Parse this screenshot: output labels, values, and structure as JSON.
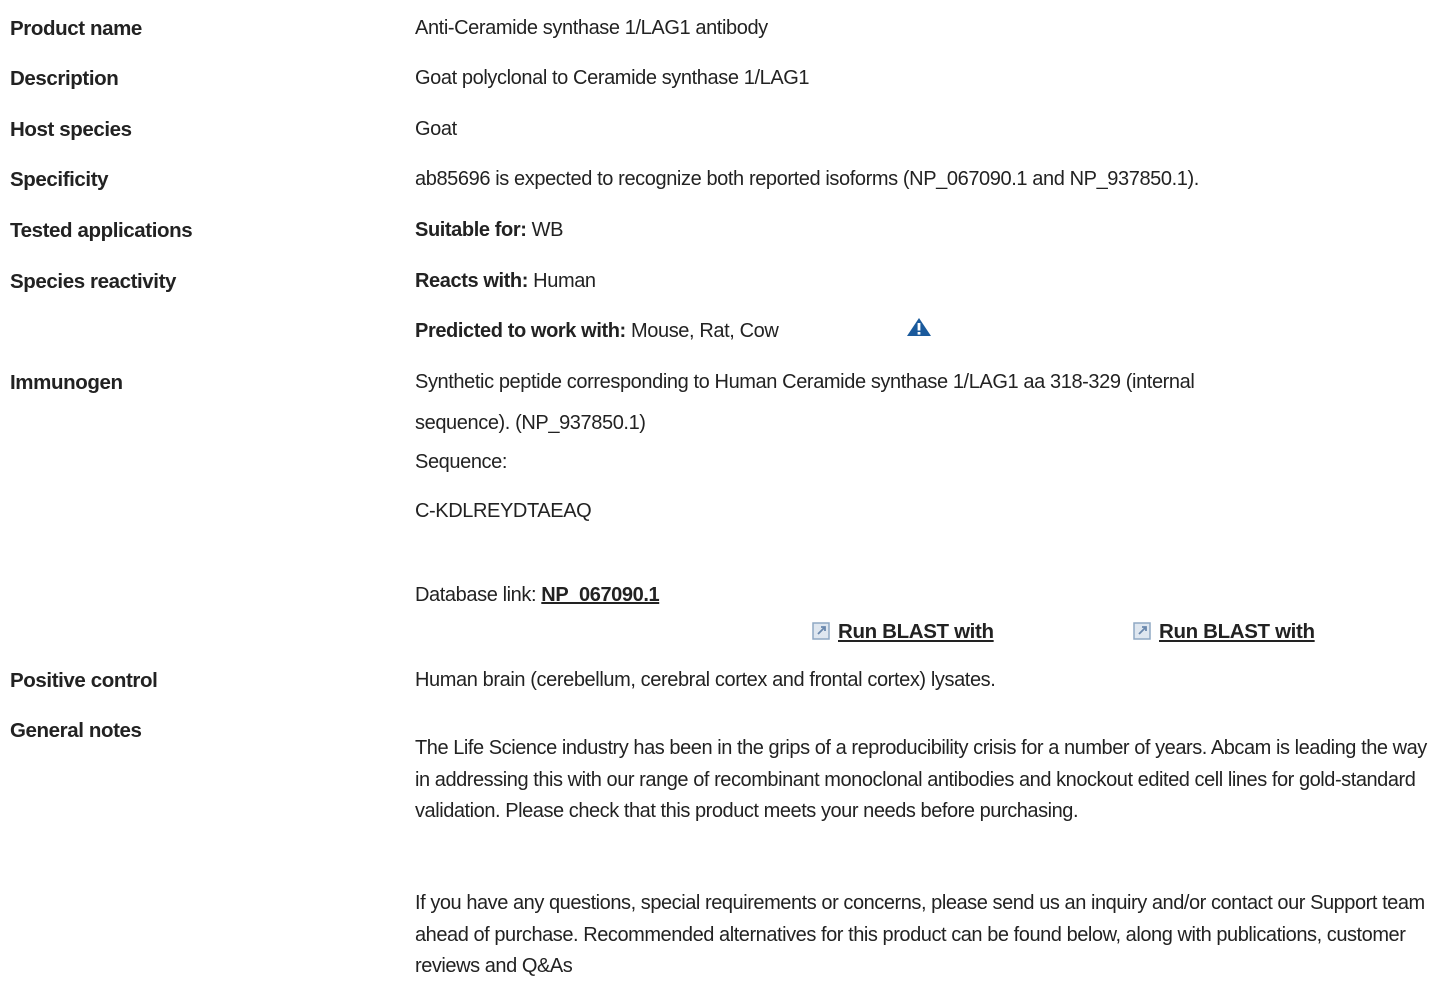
{
  "rows": {
    "product_name": {
      "label": "Product name",
      "value": "Anti-Ceramide synthase 1/LAG1 antibody"
    },
    "description": {
      "label": "Description",
      "value": "Goat polyclonal to Ceramide synthase 1/LAG1"
    },
    "host_species": {
      "label": "Host species",
      "value": "Goat"
    },
    "specificity": {
      "label": "Specificity",
      "value": "ab85696 is expected to recognize both reported isoforms (NP_067090.1 and NP_937850.1)."
    },
    "tested_applications": {
      "label": "Tested applications",
      "prefix": "Suitable for:",
      "value": " WB"
    },
    "species_reactivity": {
      "label": "Species reactivity",
      "reacts_prefix": "Reacts with:",
      "reacts_value": " Human",
      "predicted_prefix": "Predicted to work with:",
      "predicted_value": " Mouse, Rat, Cow",
      "warning_icon": "warning-triangle-icon"
    },
    "immunogen": {
      "label": "Immunogen",
      "line1": "Synthetic peptide corresponding to Human Ceramide synthase 1/LAG1 aa 318-329 (internal",
      "line2": "sequence). (NP_937850.1)",
      "sequence_label": "Sequence:",
      "sequence": "C-KDLREYDTAEAQ",
      "db_prefix": "Database link: ",
      "db_link": "NP_067090.1",
      "blast_1": "Run BLAST with",
      "blast_2": "Run BLAST with",
      "blast_icon": "external-link-icon"
    },
    "positive_control": {
      "label": "Positive control",
      "value": "Human brain (cerebellum, cerebral cortex and frontal cortex) lysates."
    },
    "general_notes": {
      "label": "General notes",
      "p1": "The Life Science industry has been in the grips of a reproducibility crisis for a number of years. Abcam is leading the way in addressing this with our range of recombinant monoclonal antibodies and knockout edited cell lines for gold-standard validation. Please check that this product meets your needs before purchasing.",
      "p2": "If you have any questions, special requirements or concerns, please send us an inquiry and/or contact our Support team ahead of purchase. Recommended alternatives for this product can be found below, along with publications, customer reviews and Q&As"
    }
  },
  "colors": {
    "text": "#222222",
    "warning_icon": "#1a5a9c",
    "link_icon": "#8fa8c4"
  }
}
